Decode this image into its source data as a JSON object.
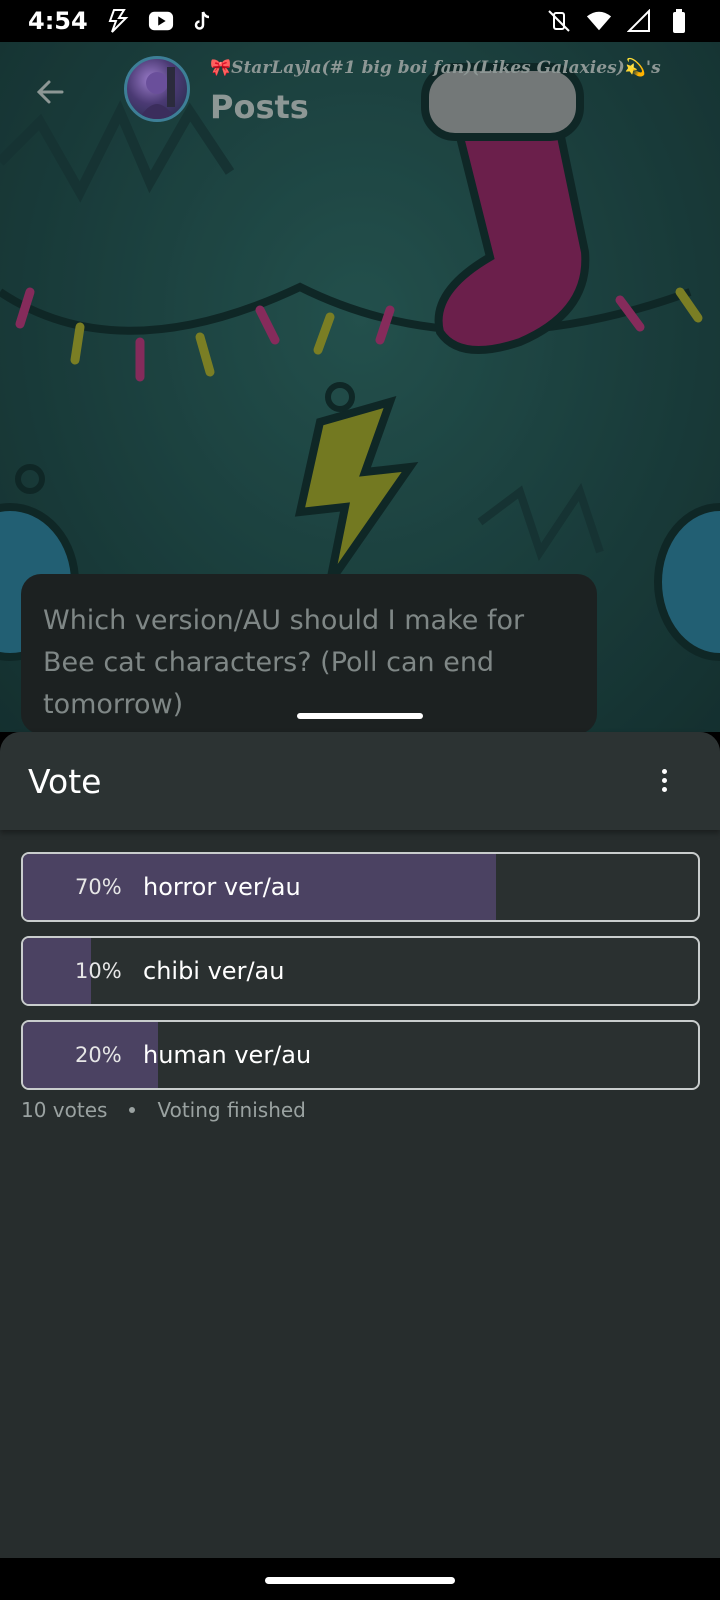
{
  "status_bar": {
    "time": "4:54",
    "icons_left": [
      "flash-icon",
      "youtube-icon",
      "tiktok-icon"
    ],
    "icons_right": [
      "vibrate-off-icon",
      "wifi-icon",
      "signal-icon",
      "battery-icon"
    ]
  },
  "header": {
    "owner_bow": "🎀",
    "owner_name": "StarLayla(#1 big boi fan)(Likes Galaxies)",
    "owner_sparkle": "💫",
    "owner_suffix": "'s",
    "title": "Posts"
  },
  "post": {
    "text": "Which version/AU should I make for Bee cat characters? (Poll can end tomorrow)"
  },
  "sheet": {
    "title": "Vote",
    "options": [
      {
        "percent_text": "70%",
        "label": "horror ver/au",
        "fraction": 0.7
      },
      {
        "percent_text": "10%",
        "label": "chibi ver/au",
        "fraction": 0.1
      },
      {
        "percent_text": "20%",
        "label": "human ver/au",
        "fraction": 0.2
      }
    ],
    "votes_text": "10 votes",
    "status_text": "Voting finished"
  },
  "colors": {
    "accent_fill": "#4b4262",
    "sheet_bg": "#272d2d"
  }
}
